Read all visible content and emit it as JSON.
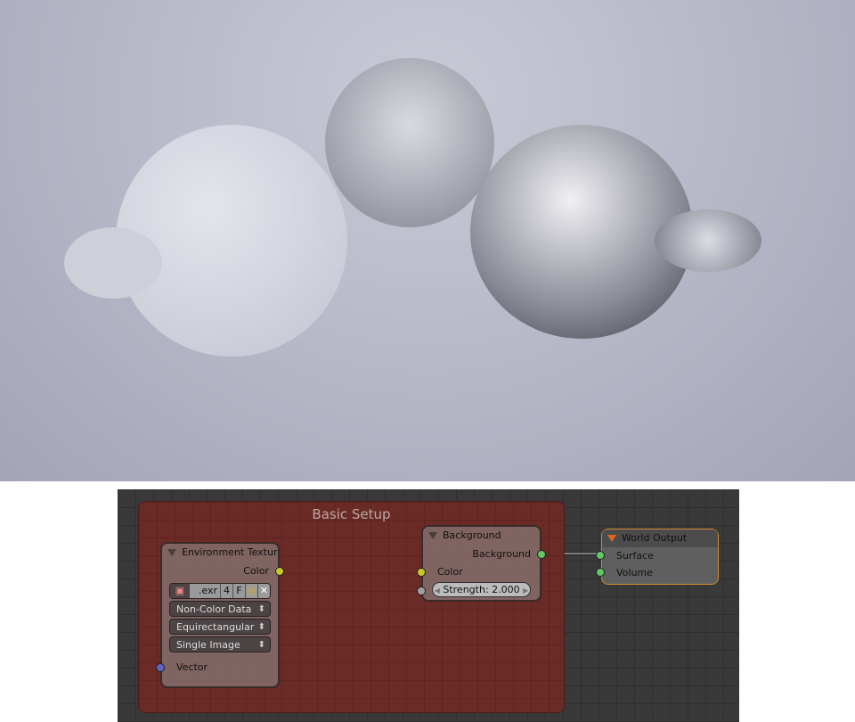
{
  "frame": {
    "title": "Basic Setup",
    "color": "#6a2a25"
  },
  "env_node": {
    "title": "Environment Textur",
    "output": "Color",
    "image_ext": ".exr",
    "users": "4",
    "fake": "F",
    "color_space": "Non-Color Data",
    "projection": "Equirectangular",
    "source": "Single Image",
    "input": "Vector"
  },
  "bg_node": {
    "title": "Background",
    "output": "Background",
    "input_color": "Color",
    "strength": "Strength: 2.000"
  },
  "world_node": {
    "title": "World Output",
    "inputs": [
      "Surface",
      "Volume"
    ]
  },
  "socket_colors": {
    "color": "#c8c82a",
    "shader": "#63c763",
    "vector": "#6363c7",
    "value": "#a1a1a1"
  }
}
